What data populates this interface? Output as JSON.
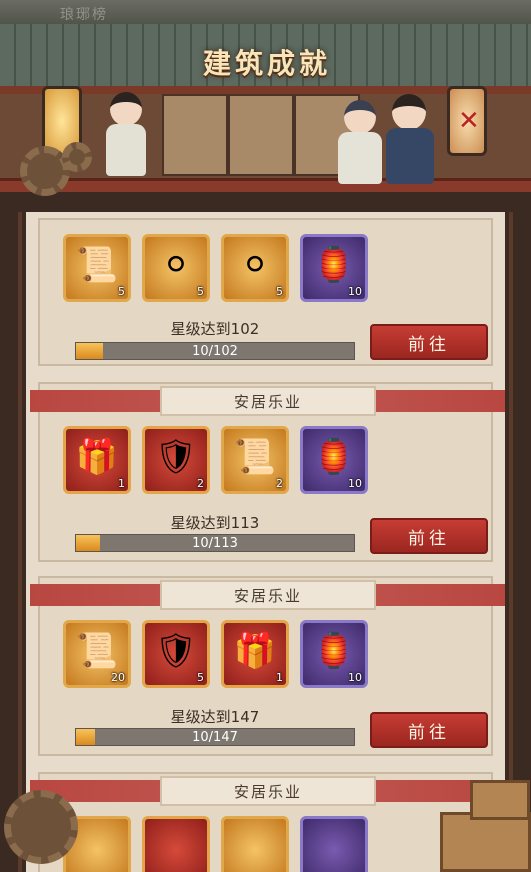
{
  "header": {
    "faded_title": "琅琊榜",
    "title": "建筑成就"
  },
  "colors": {
    "accent_red": "#b83a30",
    "progress_fill": "#e9a232",
    "paper": "#e7dccb"
  },
  "achievements": [
    {
      "banner": "",
      "items": [
        {
          "icon": "scroll-cards-icon",
          "glyph": "📜",
          "count": "5",
          "tier": "gold"
        },
        {
          "icon": "earring-icon",
          "glyph": "⚪",
          "count": "5",
          "tier": "gold"
        },
        {
          "icon": "earring-icon",
          "glyph": "⚪",
          "count": "5",
          "tier": "gold"
        },
        {
          "icon": "pendant-icon",
          "glyph": "🏮",
          "count": "10",
          "tier": "purple"
        }
      ],
      "requirement": "星级达到102",
      "progress_text": "10/102",
      "progress_fraction": 0.098,
      "button": "前往"
    },
    {
      "banner": "安居乐业",
      "items": [
        {
          "icon": "treasure-chest-icon",
          "glyph": "🎁",
          "count": "1",
          "tier": "red"
        },
        {
          "icon": "chariot-icon",
          "glyph": "🛡",
          "count": "2",
          "tier": "red"
        },
        {
          "icon": "scroll-icon",
          "glyph": "📜",
          "count": "2",
          "tier": "gold"
        },
        {
          "icon": "pendant-icon",
          "glyph": "🏮",
          "count": "10",
          "tier": "purple"
        }
      ],
      "requirement": "星级达到113",
      "progress_text": "10/113",
      "progress_fraction": 0.088,
      "button": "前往"
    },
    {
      "banner": "安居乐业",
      "items": [
        {
          "icon": "scroll-cards-icon",
          "glyph": "📜",
          "count": "20",
          "tier": "gold"
        },
        {
          "icon": "chariot-icon",
          "glyph": "🛡",
          "count": "5",
          "tier": "red"
        },
        {
          "icon": "treasure-chest-icon",
          "glyph": "🎁",
          "count": "1",
          "tier": "red"
        },
        {
          "icon": "pendant-icon",
          "glyph": "🏮",
          "count": "10",
          "tier": "purple"
        }
      ],
      "requirement": "星级达到147",
      "progress_text": "10/147",
      "progress_fraction": 0.068,
      "button": "前往"
    },
    {
      "banner": "安居乐业"
    }
  ]
}
